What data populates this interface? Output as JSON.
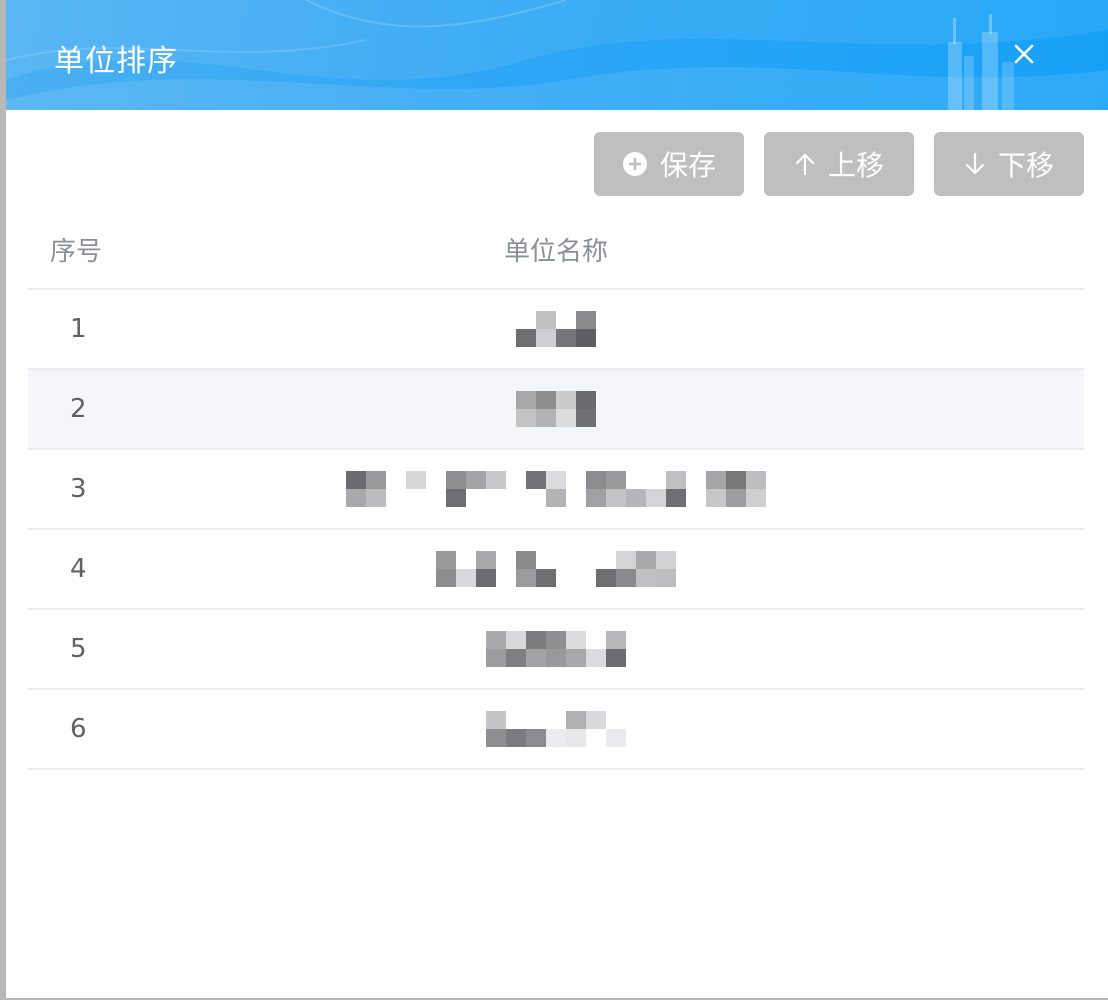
{
  "dialog": {
    "title": "单位排序",
    "close_label": "×"
  },
  "toolbar": {
    "save_label": "保存",
    "up_label": "上移",
    "down_label": "下移"
  },
  "table": {
    "headers": {
      "index": "序号",
      "name": "单位名称"
    },
    "rows": [
      {
        "index": "1"
      },
      {
        "index": "2"
      },
      {
        "index": "3"
      },
      {
        "index": "4"
      },
      {
        "index": "5"
      },
      {
        "index": "6"
      }
    ]
  },
  "colors": {
    "header_blue": "#2ea6f5",
    "button_gray": "#bfbfbf",
    "stripe": "#f5f6f9"
  },
  "icons": [
    "plus-circle-icon",
    "arrow-up-icon",
    "arrow-down-icon",
    "close-icon"
  ]
}
